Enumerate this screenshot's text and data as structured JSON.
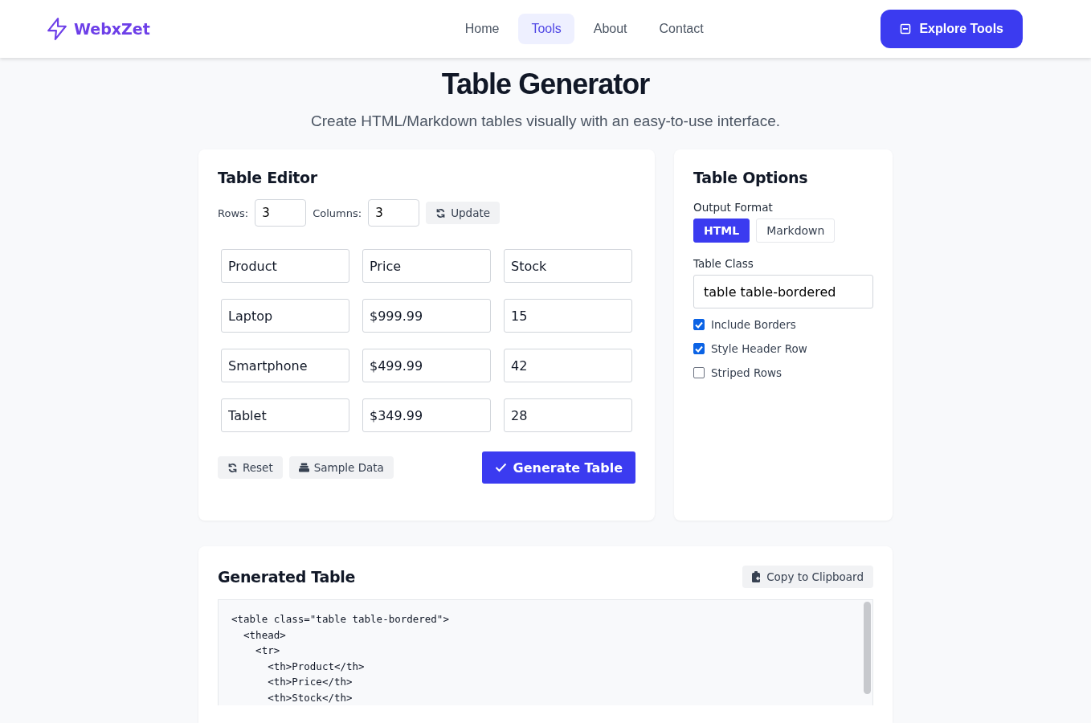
{
  "nav": {
    "brand": "WebxZet",
    "links": [
      {
        "label": "Home",
        "selected": false
      },
      {
        "label": "Tools",
        "selected": true
      },
      {
        "label": "About",
        "selected": false
      },
      {
        "label": "Contact",
        "selected": false
      }
    ],
    "cta": "Explore Tools"
  },
  "hero": {
    "title": "Table Generator",
    "subtitle": "Create HTML/Markdown tables visually with an easy-to-use interface."
  },
  "editor": {
    "title": "Table Editor",
    "rows_label": "Rows:",
    "rows_value": "3",
    "columns_label": "Columns:",
    "columns_value": "3",
    "update": "Update",
    "cells": [
      [
        "Product",
        "Price",
        "Stock"
      ],
      [
        "Laptop",
        "$999.99",
        "15"
      ],
      [
        "Smartphone",
        "$499.99",
        "42"
      ],
      [
        "Tablet",
        "$349.99",
        "28"
      ]
    ],
    "reset": "Reset",
    "sample": "Sample Data",
    "generate": "Generate Table"
  },
  "options": {
    "title": "Table Options",
    "format_label": "Output Format",
    "formats": [
      {
        "label": "HTML",
        "selected": true
      },
      {
        "label": "Markdown",
        "selected": false
      }
    ],
    "class_label": "Table Class",
    "class_value": "table table-bordered",
    "checks": [
      {
        "label": "Include Borders",
        "checked": true
      },
      {
        "label": "Style Header Row",
        "checked": true
      },
      {
        "label": "Striped Rows",
        "checked": false
      }
    ]
  },
  "output": {
    "title": "Generated Table",
    "copy": "Copy to Clipboard",
    "code": [
      "<table class=\"table table-bordered\">",
      "  <thead>",
      "    <tr>",
      "      <th>Product</th>",
      "      <th>Price</th>",
      "      <th>Stock</th>"
    ]
  }
}
